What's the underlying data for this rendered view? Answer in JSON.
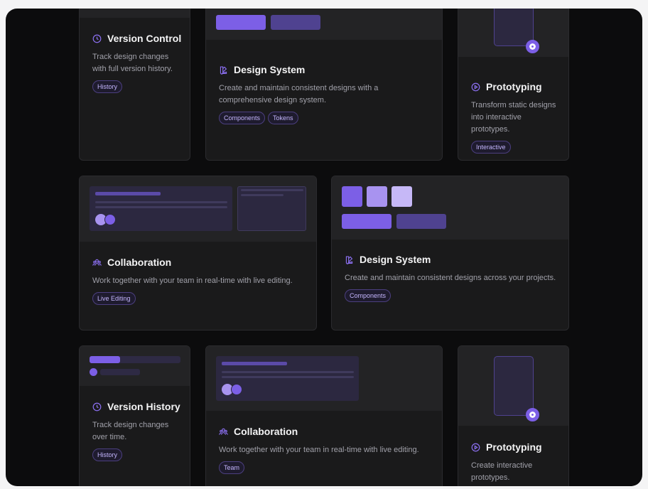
{
  "colors": {
    "accent": "#7c5fe6",
    "accent_light": "#a893f0",
    "background": "#0c0c0d",
    "card": "#1a1a1b"
  },
  "cards": {
    "version_control": {
      "icon": "clock-icon",
      "title": "Version Control",
      "desc": "Track design changes with full version history.",
      "tags": [
        "History"
      ]
    },
    "design_system_1": {
      "icon": "palette-icon",
      "title": "Design System",
      "desc": "Create and maintain consistent designs with a comprehensive design system.",
      "tags": [
        "Components",
        "Tokens"
      ]
    },
    "prototyping_1": {
      "icon": "play-circle-icon",
      "title": "Prototyping",
      "desc": "Transform static designs into interactive prototypes.",
      "tags": [
        "Interactive"
      ]
    },
    "collaboration_1": {
      "icon": "users-icon",
      "title": "Collaboration",
      "desc": "Work together with your team in real-time with live editing.",
      "tags": [
        "Live Editing"
      ]
    },
    "design_system_2": {
      "icon": "palette-icon",
      "title": "Design System",
      "desc": "Create and maintain consistent designs across your projects.",
      "tags": [
        "Components"
      ]
    },
    "version_history": {
      "icon": "clock-icon",
      "title": "Version History",
      "desc": "Track design changes over time.",
      "tags": [
        "History"
      ]
    },
    "collaboration_2": {
      "icon": "users-icon",
      "title": "Collaboration",
      "desc": "Work together with your team in real-time with live editing.",
      "tags": [
        "Team"
      ]
    },
    "prototyping_2": {
      "icon": "play-circle-icon",
      "title": "Prototyping",
      "desc": "Create interactive prototypes.",
      "tags": []
    }
  }
}
